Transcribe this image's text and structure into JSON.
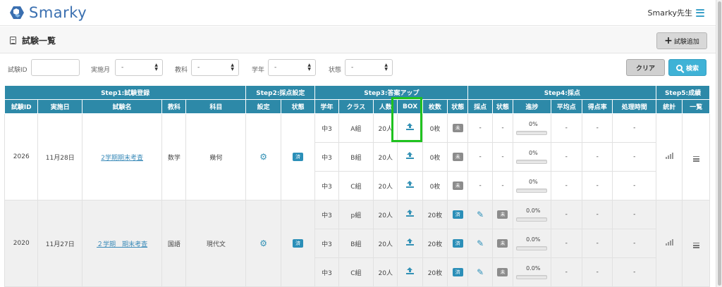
{
  "app": {
    "logo_text": "Smarky",
    "teacher": "Smarky先生"
  },
  "page": {
    "title": "試験一覧",
    "add_button": "試験追加"
  },
  "filters": {
    "exam_id_label": "試験ID",
    "month_label": "実施月",
    "month_value": "-",
    "subject_label": "教科",
    "subject_value": "-",
    "grade_label": "学年",
    "grade_value": "-",
    "status_label": "状態",
    "status_value": "-",
    "clear_button": "クリア",
    "search_button": "検索"
  },
  "table": {
    "groups": {
      "step1": "Step1:試験登録",
      "step2": "Step2:採点設定",
      "step3": "Step3:答案アップ",
      "step4": "Step4:採点",
      "step5": "Step5:成績"
    },
    "columns": [
      "試験ID",
      "実施日",
      "試験名",
      "教科",
      "科目",
      "設定",
      "状態",
      "学年",
      "クラス",
      "人数",
      "BOX",
      "枚数",
      "状態",
      "採点",
      "状態",
      "進捗",
      "平均点",
      "得点率",
      "処理時間",
      "統計",
      "一覧"
    ],
    "exams": [
      {
        "id": "2026",
        "date": "11月28日",
        "name": "2学期期末考査",
        "subject": "数学",
        "course": "幾何",
        "setting_status": "済",
        "rows": [
          {
            "grade": "中3",
            "class": "A組",
            "count": "20人",
            "sheets": "0枚",
            "up_status": "未",
            "scoring": "-",
            "score_status": "-",
            "progress": "0%",
            "avg": "-",
            "rate": "-",
            "time": "-"
          },
          {
            "grade": "中3",
            "class": "B組",
            "count": "20人",
            "sheets": "0枚",
            "up_status": "未",
            "scoring": "-",
            "score_status": "-",
            "progress": "0%",
            "avg": "-",
            "rate": "-",
            "time": "-"
          },
          {
            "grade": "中3",
            "class": "C組",
            "count": "20人",
            "sheets": "0枚",
            "up_status": "未",
            "scoring": "-",
            "score_status": "-",
            "progress": "0%",
            "avg": "-",
            "rate": "-",
            "time": "-"
          }
        ]
      },
      {
        "id": "2020",
        "date": "11月27日",
        "name": "２学期　期末考査",
        "subject": "国語",
        "course": "現代文",
        "setting_status": "済",
        "rows": [
          {
            "grade": "中3",
            "class": "p組",
            "count": "20人",
            "sheets": "20枚",
            "up_status": "済",
            "score_status": "未",
            "progress": "0.0%",
            "avg": "-",
            "rate": "-",
            "time": "-"
          },
          {
            "grade": "中3",
            "class": "B組",
            "count": "20人",
            "sheets": "20枚",
            "up_status": "済",
            "score_status": "未",
            "progress": "0.0%",
            "avg": "-",
            "rate": "-",
            "time": "-"
          },
          {
            "grade": "中3",
            "class": "C組",
            "count": "20人",
            "sheets": "20枚",
            "up_status": "済",
            "score_status": "未",
            "progress": "0.0%",
            "avg": "-",
            "rate": "-",
            "time": "-"
          }
        ]
      }
    ]
  },
  "colors": {
    "header": "#2d89a8",
    "accent": "#3fb2d6",
    "highlight": "#1fc21f"
  },
  "icons": {
    "settings": "gear-icon",
    "upload": "upload-icon",
    "edit": "pencil-icon",
    "stats": "signal-icon",
    "list": "list-icon"
  }
}
